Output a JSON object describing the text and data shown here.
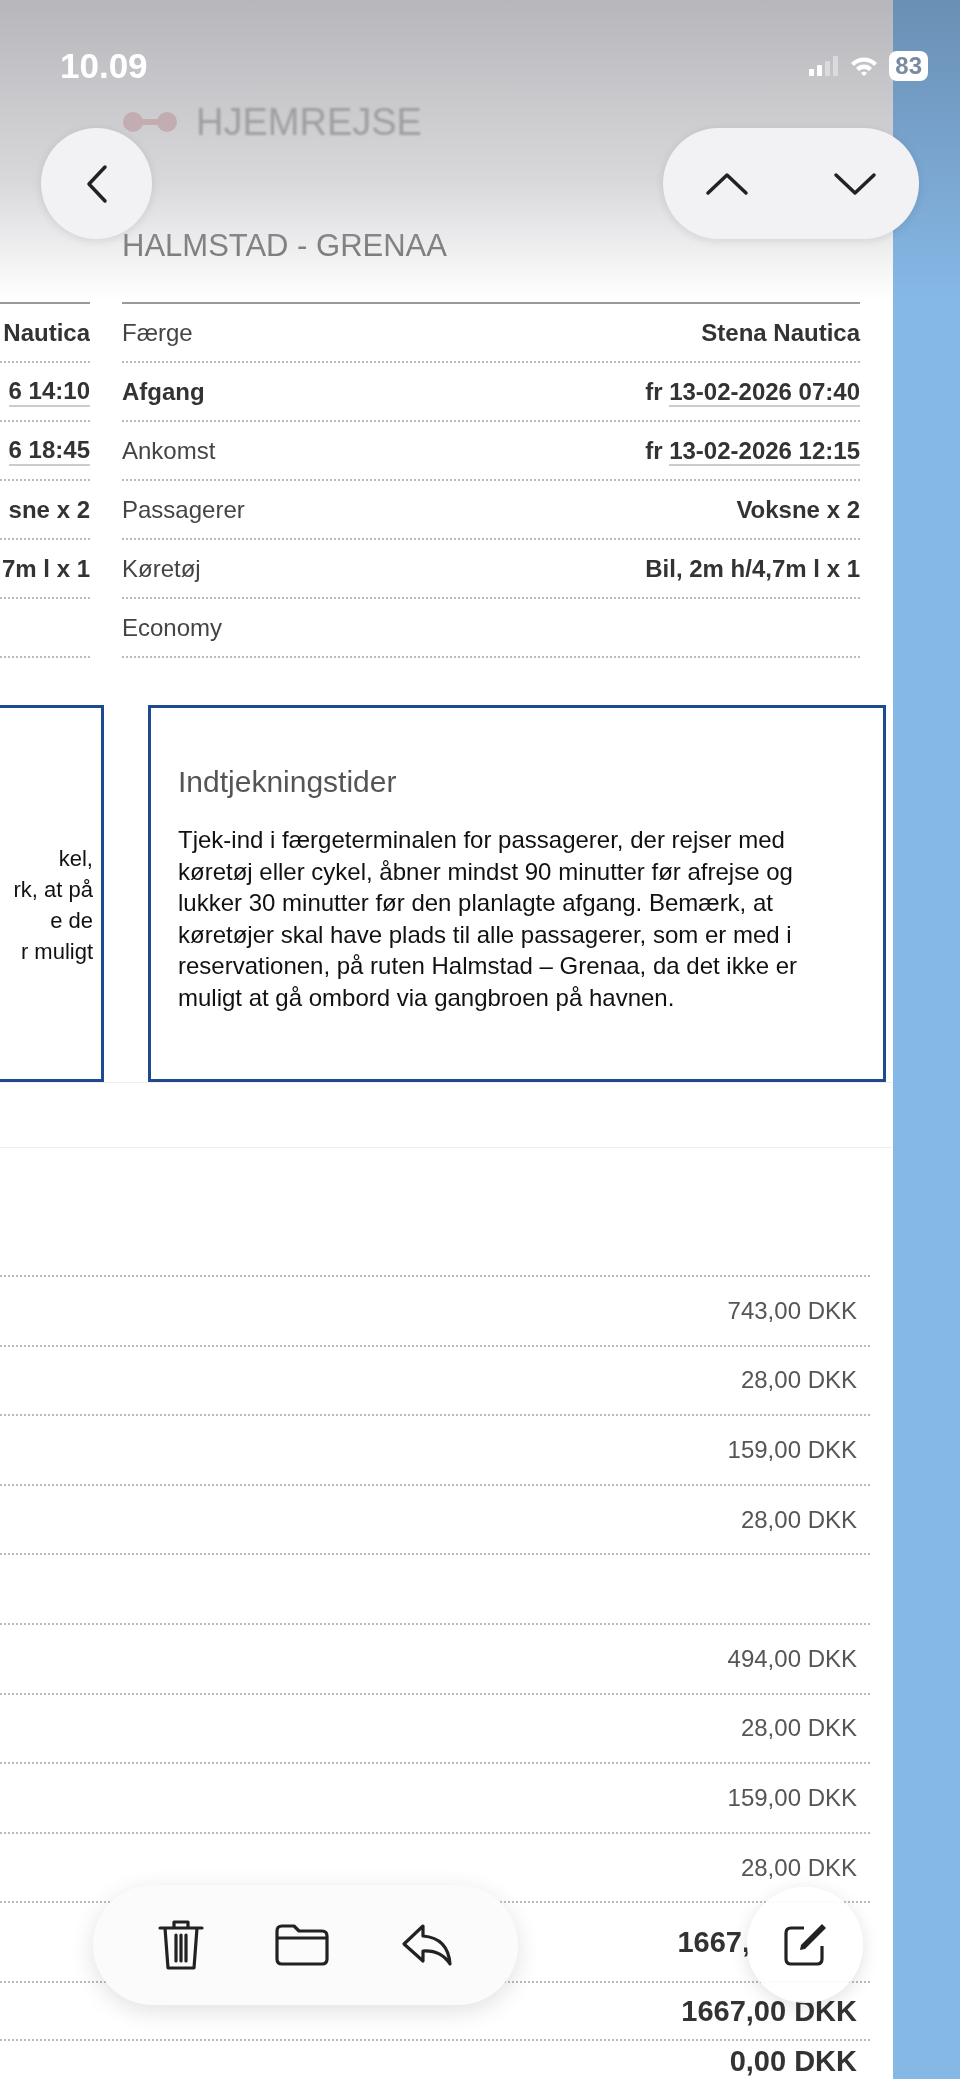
{
  "status_bar": {
    "time": "10.09",
    "battery": "83"
  },
  "header": {
    "title": "HJEMREJSE",
    "route": "HALMSTAD - GRENAA"
  },
  "left_column": {
    "rows": [
      {
        "value": "Nautica",
        "underlined": false
      },
      {
        "value": "6 14:10",
        "underlined": true
      },
      {
        "value": "6 18:45",
        "underlined": true
      },
      {
        "value": "sne x 2",
        "underlined": false
      },
      {
        "value": "7m l x 1",
        "underlined": false
      }
    ],
    "notice_lines": [
      "kel,",
      "rk, at på",
      "e de",
      "r muligt"
    ]
  },
  "details": [
    {
      "label": "Færge",
      "bold_label": false,
      "value": "Stena Nautica",
      "underlined": false
    },
    {
      "label": "Afgang",
      "bold_label": true,
      "day": "fr",
      "value": "13-02-2026 07:40",
      "underlined": true
    },
    {
      "label": "Ankomst",
      "bold_label": false,
      "day": "fr",
      "value": "13-02-2026 12:15",
      "underlined": true
    },
    {
      "label": "Passagerer",
      "bold_label": false,
      "value": "Voksne x 2",
      "underlined": false
    },
    {
      "label": "Køretøj",
      "bold_label": false,
      "value": "Bil, 2m h/4,7m l x 1",
      "underlined": false
    },
    {
      "label": "Economy",
      "bold_label": false
    }
  ],
  "notice": {
    "title": "Indtjekningstider",
    "text": "Tjek-ind i færgeterminalen for passagerer, der rejser med køretøj eller cykel, åbner mindst 90 minutter før afrejse og lukker 30 minutter før den planlagte afgang. Bemærk, at køretøjer skal have plads til alle passagerer, som er med i reservationen, på ruten Halmstad – Grenaa, da det ikke er muligt at gå ombord via gangbroen på havnen."
  },
  "prices": [
    {
      "kind": "amount",
      "value": "743,00 DKK"
    },
    {
      "kind": "amount",
      "value": "28,00 DKK"
    },
    {
      "kind": "amount",
      "value": "159,00 DKK"
    },
    {
      "kind": "amount",
      "value": "28,00 DKK"
    },
    {
      "kind": "blank"
    },
    {
      "kind": "amount",
      "value": "494,00 DKK"
    },
    {
      "kind": "amount",
      "value": "28,00 DKK"
    },
    {
      "kind": "amount",
      "value": "159,00 DKK"
    },
    {
      "kind": "amount",
      "value": "28,00 DKK"
    },
    {
      "kind": "total",
      "value": "1667,"
    },
    {
      "kind": "total",
      "value": "1667,00 DKK"
    },
    {
      "kind": "total",
      "value": "0,00 DKK"
    }
  ]
}
